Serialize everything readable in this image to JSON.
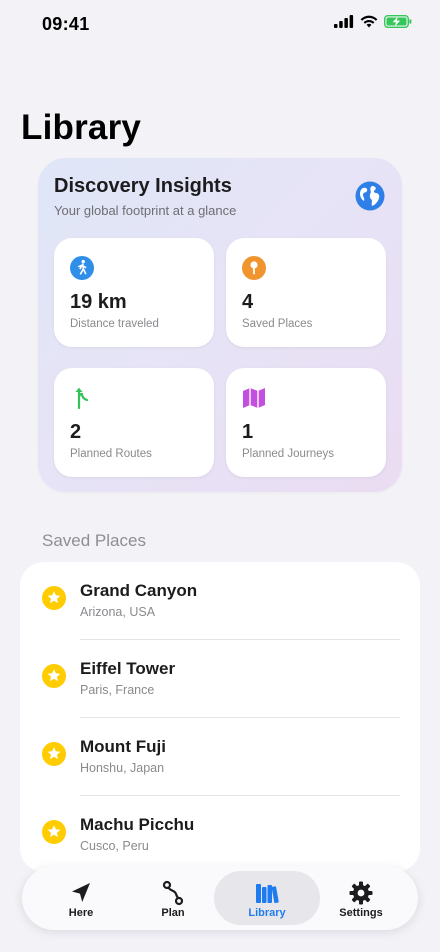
{
  "status": {
    "time": "09:41"
  },
  "page": {
    "title": "Library"
  },
  "insights": {
    "title": "Discovery Insights",
    "subtitle": "Your global footprint at a glance",
    "stats": [
      {
        "value": "19 km",
        "label": "Distance traveled",
        "icon": "walk-icon",
        "color": "#2f8fe8"
      },
      {
        "value": "4",
        "label": "Saved Places",
        "icon": "pin-icon",
        "color": "#f0952e"
      },
      {
        "value": "2",
        "label": "Planned Routes",
        "icon": "route-icon",
        "color": "#33c25a"
      },
      {
        "value": "1",
        "label": "Planned Journeys",
        "icon": "map-icon",
        "color": "#c24fe0"
      }
    ]
  },
  "saved": {
    "header": "Saved Places",
    "items": [
      {
        "name": "Grand Canyon",
        "location": "Arizona, USA"
      },
      {
        "name": "Eiffel Tower",
        "location": "Paris, France"
      },
      {
        "name": "Mount Fuji",
        "location": "Honshu, Japan"
      },
      {
        "name": "Machu Picchu",
        "location": "Cusco, Peru"
      }
    ]
  },
  "tabs": [
    {
      "label": "Here",
      "icon": "location-arrow-icon"
    },
    {
      "label": "Plan",
      "icon": "route-icon"
    },
    {
      "label": "Library",
      "icon": "books-icon",
      "active": true
    },
    {
      "label": "Settings",
      "icon": "gear-icon"
    }
  ],
  "colors": {
    "accent": "#1f7cf0",
    "star": "#ffcc00",
    "battery": "#34c759"
  }
}
